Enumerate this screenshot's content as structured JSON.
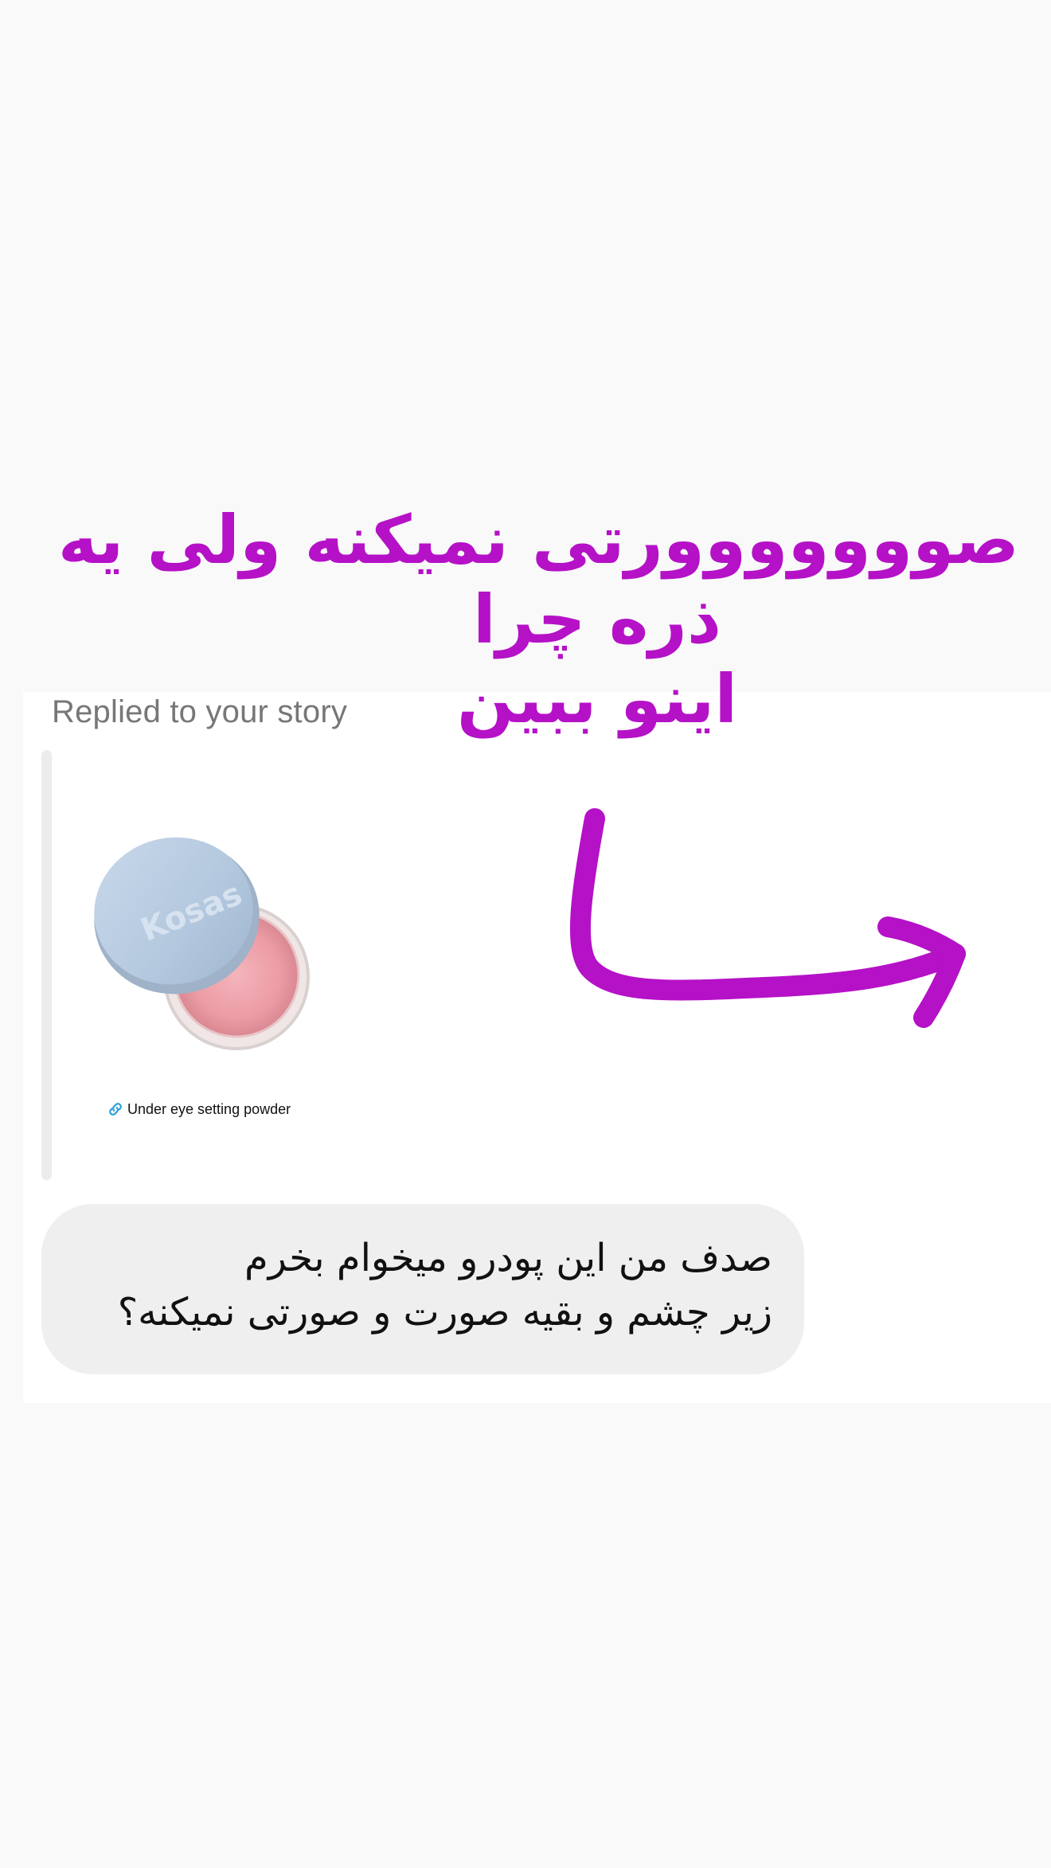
{
  "story_reply": {
    "label": "Replied to your story",
    "link_sticker_text": "Under eye setting powder",
    "product_brand": "Kosas"
  },
  "message": {
    "line1": "صدف من این پودرو میخوام بخرم",
    "line2": "زیر چشم و بقیه صورت و صورتی نمیکنه؟"
  },
  "overlay": {
    "line1": "صووووووورتی نمیکنه ولی یه",
    "line2": "ذره چرا",
    "line3": "اینو ببین",
    "color": "#b511c7"
  },
  "icons": {
    "link": "link-icon",
    "arrow": "hand-drawn-arrow-icon"
  }
}
